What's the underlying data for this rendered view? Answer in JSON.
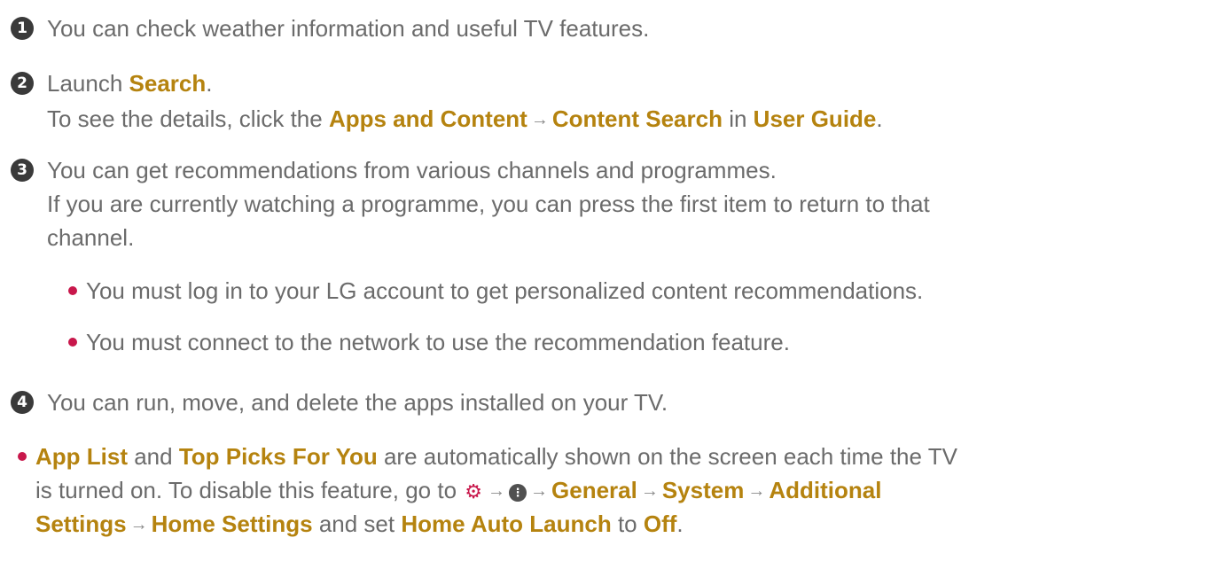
{
  "items": [
    {
      "num": "1",
      "text": "You can check weather information and useful TV features."
    },
    {
      "num": "2",
      "launch": "Launch ",
      "search": "Search",
      "period": ".",
      "details_pre": "To see the details, click the ",
      "apps_content": "Apps and Content",
      "content_search": "Content Search",
      "in": " in ",
      "user_guide": "User Guide",
      "period2": "."
    },
    {
      "num": "3",
      "line1": "You can get recommendations from various channels and programmes.",
      "line2": "If you are currently watching a programme, you can press the first item to return to that",
      "line3": "channel.",
      "bullets": [
        "You must log in to your LG account to get personalized content recommendations.",
        "You must connect to the network to use the recommendation feature."
      ]
    },
    {
      "num": "4",
      "text": "You can run, move, and delete the apps installed on your TV."
    }
  ],
  "note": {
    "app_list": "App List",
    "and": " and ",
    "top_picks": "Top Picks For You",
    "rest1": " are automatically shown on the screen each time the TV",
    "line2_pre": "is turned on. To disable this feature, go to ",
    "general": "General",
    "system": "System",
    "additional": "Additional",
    "settings": "Settings",
    "home_settings": "Home Settings",
    "and_set": " and set ",
    "home_auto_launch": "Home Auto Launch",
    "to": " to ",
    "off": "Off",
    "period": "."
  },
  "icons": {
    "arrow": "→",
    "gear": "⚙",
    "more": "⋮"
  }
}
